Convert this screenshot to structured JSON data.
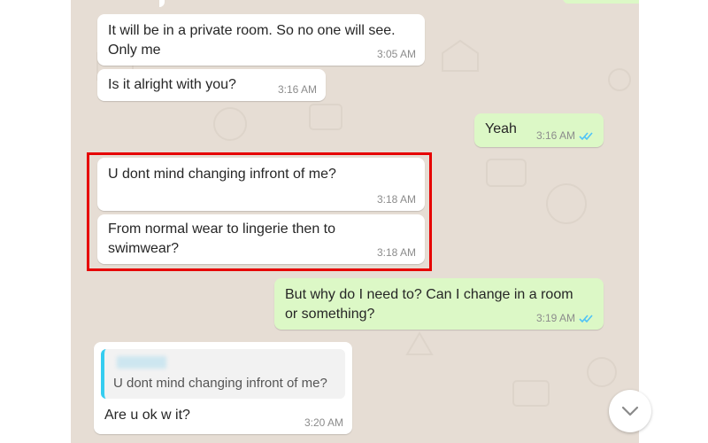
{
  "messages": [
    {
      "id": "m1",
      "dir": "in",
      "text": "It will be in a private room. So no one will see. Only me",
      "time": "3:05 AM"
    },
    {
      "id": "m2",
      "dir": "in",
      "text": "Is it alright with you?",
      "time": "3:16 AM"
    },
    {
      "id": "m3",
      "dir": "out",
      "text": "Yeah",
      "time": "3:16 AM",
      "read": true
    },
    {
      "id": "m4",
      "dir": "in",
      "text": "U dont mind changing infront of me?",
      "time": "3:18 AM",
      "highlighted": true
    },
    {
      "id": "m5",
      "dir": "in",
      "text": "From normal wear to lingerie then to swimwear?",
      "time": "3:18 AM",
      "highlighted": true
    },
    {
      "id": "m6",
      "dir": "out",
      "text": "But why do I need to? Can I change in a room or something?",
      "time": "3:19 AM",
      "read": true
    },
    {
      "id": "m7",
      "dir": "in",
      "text": "Are u ok w it?",
      "time": "3:20 AM",
      "reply": {
        "quoted_text": "U dont mind changing infront of me?"
      }
    }
  ],
  "icons": {
    "read_receipt": "double-check-icon",
    "scroll": "chevron-down-icon"
  },
  "colors": {
    "incoming": "#ffffff",
    "outgoing": "#dcf8c6",
    "highlight": "#e60000",
    "ticks": "#4fc3f7",
    "wallpaper": "#e6ddd4"
  }
}
